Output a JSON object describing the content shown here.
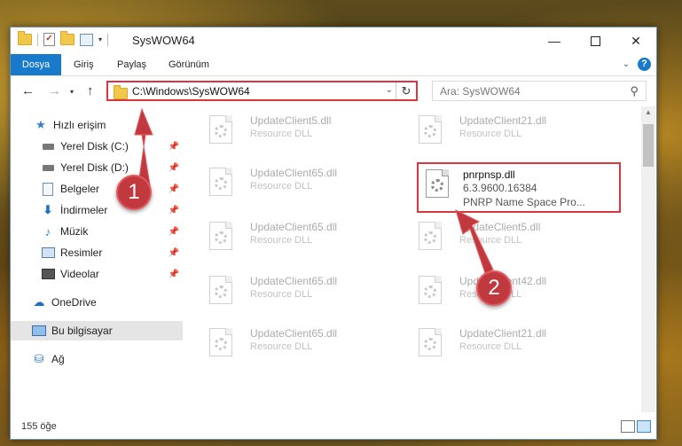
{
  "window": {
    "title": "SysWOW64"
  },
  "ribbon": {
    "tabs": [
      "Dosya",
      "Giriş",
      "Paylaş",
      "Görünüm"
    ],
    "help": "?"
  },
  "nav": {
    "address": "C:\\Windows\\SysWOW64",
    "search_placeholder": "Ara: SysWOW64"
  },
  "sidebar": {
    "items": [
      {
        "label": "Hızlı erişim",
        "icon": "star-icon"
      },
      {
        "label": "Yerel Disk (C:)",
        "icon": "drive-icon",
        "pinned": true
      },
      {
        "label": "Yerel Disk (D:)",
        "icon": "drive-icon",
        "pinned": true
      },
      {
        "label": "Belgeler",
        "icon": "documents-icon",
        "pinned": true
      },
      {
        "label": "İndirmeler",
        "icon": "downloads-icon",
        "pinned": true
      },
      {
        "label": "Müzik",
        "icon": "music-icon",
        "pinned": true
      },
      {
        "label": "Resimler",
        "icon": "pictures-icon",
        "pinned": true
      },
      {
        "label": "Videolar",
        "icon": "videos-icon",
        "pinned": true
      },
      {
        "label": "OneDrive",
        "icon": "onedrive-icon"
      },
      {
        "label": "Bu bilgisayar",
        "icon": "this-pc-icon",
        "selected": true
      },
      {
        "label": "Ağ",
        "icon": "network-icon"
      }
    ]
  },
  "files": [
    {
      "name": "UpdateClient5.dll",
      "desc": "Resource DLL"
    },
    {
      "name": "UpdateClient21.dll",
      "desc": "Resource DLL"
    },
    {
      "name": "UpdateClient65.dll",
      "desc": "Resource DLL"
    },
    {
      "name": "pnrpnsp.dll",
      "version": "6.3.9600.16384",
      "desc": "PNRP Name Space Pro..."
    },
    {
      "name": "UpdateClient65.dll",
      "desc": "Resource DLL"
    },
    {
      "name": "UpdateClient5.dll",
      "desc": "Resource DLL"
    },
    {
      "name": "UpdateClient65.dll",
      "desc": "Resource DLL"
    },
    {
      "name": "UpdateClient42.dll",
      "desc": "Resource DLL"
    },
    {
      "name": "UpdateClient65.dll",
      "desc": "Resource DLL"
    },
    {
      "name": "UpdateClient21.dll",
      "desc": "Resource DLL"
    }
  ],
  "status": {
    "item_count": "155 öğe"
  },
  "callouts": [
    "1",
    "2"
  ],
  "colors": {
    "accent": "#1979ca",
    "highlight": "#d9363e",
    "callout": "#c0393f"
  }
}
